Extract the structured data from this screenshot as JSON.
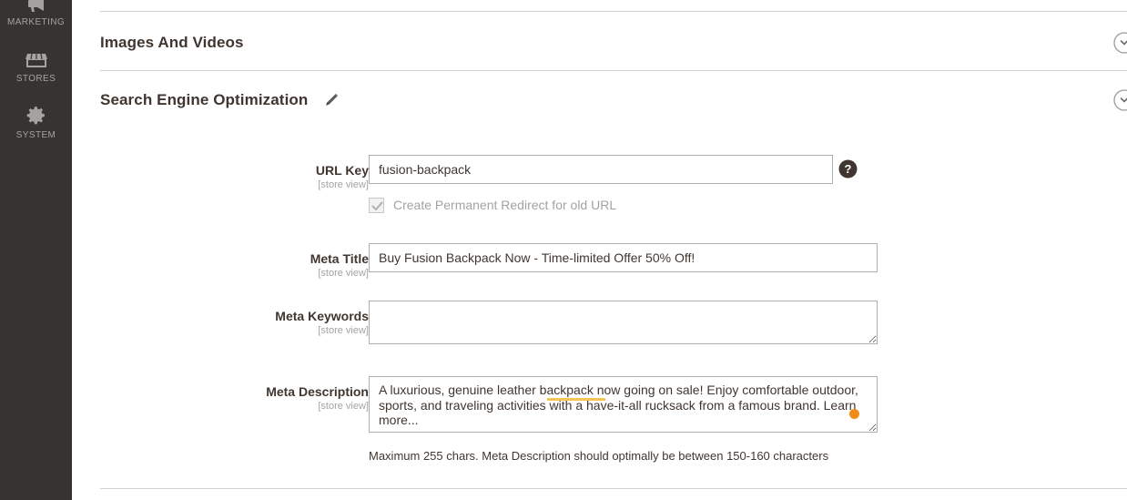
{
  "sidebar": {
    "items": [
      {
        "label": "MARKETING",
        "icon": "megaphone-icon"
      },
      {
        "label": "STORES",
        "icon": "storefront-icon"
      },
      {
        "label": "SYSTEM",
        "icon": "gear-icon"
      }
    ],
    "background_color": "#373330",
    "label_color": "#a6a29f"
  },
  "sections": {
    "images_and_videos": {
      "title": "Images And Videos",
      "collapse_icon": "chevron-circle-icon"
    },
    "search_engine_optimization": {
      "title": "Search Engine Optimization",
      "edit_icon": "pencil-icon",
      "collapse_icon": "chevron-circle-icon"
    }
  },
  "form": {
    "url_key": {
      "label": "URL Key",
      "scope": "[store view]",
      "value": "fusion-backpack",
      "placeholder": "",
      "help_icon": "question-mark-icon"
    },
    "create_redirect": {
      "label": "Create Permanent Redirect for old URL",
      "checked": true,
      "disabled": true
    },
    "meta_title": {
      "label": "Meta Title",
      "scope": "[store view]",
      "value": "Buy Fusion Backpack Now - Time-limited Offer 50% Off!",
      "placeholder": ""
    },
    "meta_keywords": {
      "label": "Meta Keywords",
      "scope": "[store view]",
      "value": "",
      "placeholder": ""
    },
    "meta_description": {
      "label": "Meta Description",
      "scope": "[store view]",
      "value": "A luxurious, genuine leather backpack now going on sale! Enjoy comfortable outdoor, sports, and traveling activities with a have-it-all rucksack from a famous brand. Learn more...",
      "placeholder": "",
      "note": "Maximum 255 chars. Meta Description should optimally be between 150-160 characters",
      "spellcheck_word": "backpack",
      "spellcheck_color": "#f6c453",
      "cursor_marker_color": "#f28c18"
    }
  },
  "theme": {
    "page_background": "#ffffff",
    "divider_color": "#d1d1d1",
    "text_color": "#41362f",
    "muted_text_color": "#a3a3a3",
    "input_border_color": "#adadad"
  }
}
